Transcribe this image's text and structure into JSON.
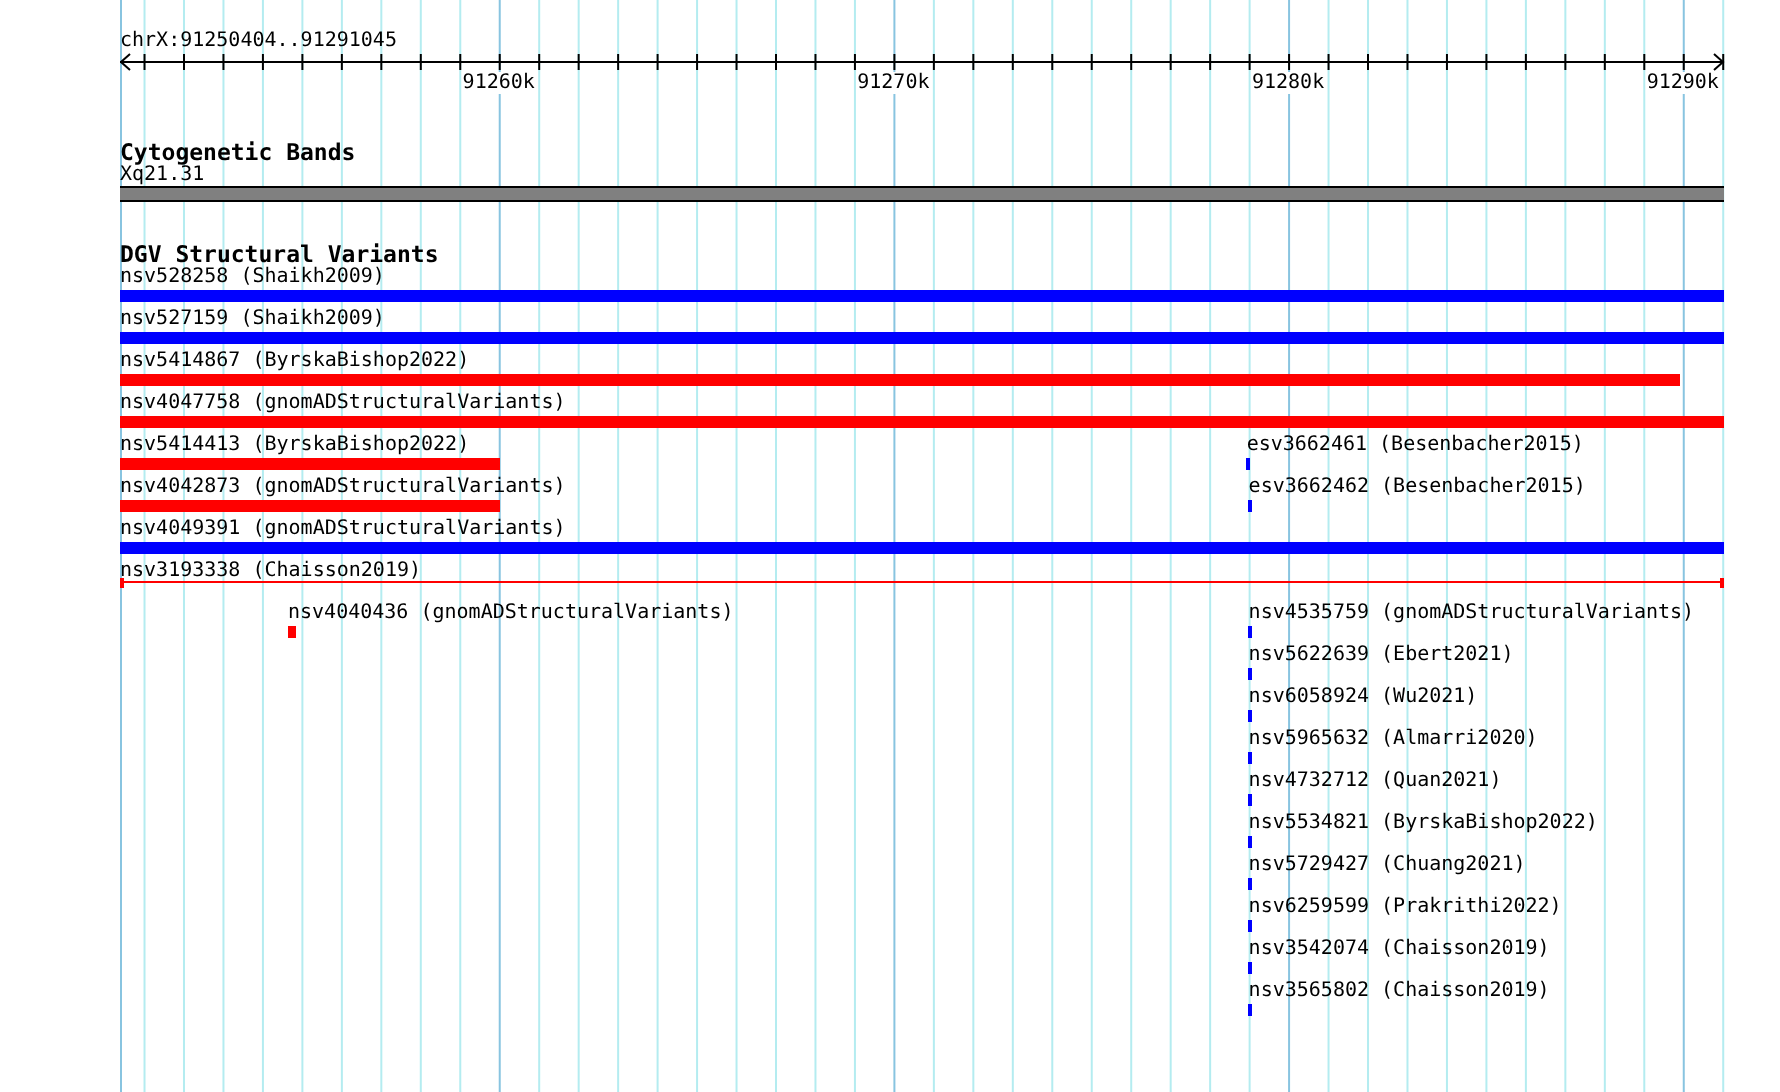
{
  "ruler": {
    "location": "chrX:91250404..91291045",
    "ticks": [
      "91260k",
      "91270k",
      "91280k",
      "91290k"
    ]
  },
  "cytogenetic_track": {
    "title": "Cytogenetic Bands",
    "band": "Xq21.31"
  },
  "dgv_track": {
    "title": "DGV Structural Variants",
    "rows": [
      {
        "features": [
          {
            "label": "nsv528258 (Shaikh2009)",
            "color": "#0000ff",
            "kind": "bar"
          }
        ]
      },
      {
        "features": [
          {
            "label": "nsv527159 (Shaikh2009)",
            "color": "#0000ff",
            "kind": "bar"
          }
        ]
      },
      {
        "features": [
          {
            "label": "nsv5414867 (ByrskaBishop2022)",
            "color": "#ff0000",
            "kind": "bar"
          }
        ]
      },
      {
        "features": [
          {
            "label": "nsv4047758 (gnomADStructuralVariants)",
            "color": "#ff0000",
            "kind": "bar"
          }
        ]
      },
      {
        "features": [
          {
            "label": "nsv5414413 (ByrskaBishop2022)",
            "color": "#ff0000",
            "kind": "bar"
          },
          {
            "label": "esv3662461 (Besenbacher2015)",
            "color": "#0000ff",
            "kind": "bar"
          }
        ]
      },
      {
        "features": [
          {
            "label": "nsv4042873 (gnomADStructuralVariants)",
            "color": "#ff0000",
            "kind": "bar"
          },
          {
            "label": "esv3662462 (Besenbacher2015)",
            "color": "#0000ff",
            "kind": "bar"
          }
        ]
      },
      {
        "features": [
          {
            "label": "nsv4049391 (gnomADStructuralVariants)",
            "color": "#0000ff",
            "kind": "bar"
          }
        ]
      },
      {
        "features": [
          {
            "label": "nsv3193338 (Chaisson2019)",
            "color": "#ff0000",
            "kind": "line"
          }
        ]
      },
      {
        "features": [
          {
            "label": "nsv4040436 (gnomADStructuralVariants)",
            "color": "#ff0000",
            "kind": "bar"
          },
          {
            "label": "nsv4535759 (gnomADStructuralVariants)",
            "color": "#0000ff",
            "kind": "bar"
          }
        ]
      },
      {
        "features": [
          {
            "label": "nsv5622639 (Ebert2021)",
            "color": "#0000ff",
            "kind": "bar"
          }
        ]
      },
      {
        "features": [
          {
            "label": "nsv6058924 (Wu2021)",
            "color": "#0000ff",
            "kind": "bar"
          }
        ]
      },
      {
        "features": [
          {
            "label": "nsv5965632 (Almarri2020)",
            "color": "#0000ff",
            "kind": "bar"
          }
        ]
      },
      {
        "features": [
          {
            "label": "nsv4732712 (Quan2021)",
            "color": "#0000ff",
            "kind": "bar"
          }
        ]
      },
      {
        "features": [
          {
            "label": "nsv5534821 (ByrskaBishop2022)",
            "color": "#0000ff",
            "kind": "bar"
          }
        ]
      },
      {
        "features": [
          {
            "label": "nsv5729427 (Chuang2021)",
            "color": "#0000ff",
            "kind": "bar"
          }
        ]
      },
      {
        "features": [
          {
            "label": "nsv6259599 (Prakrithi2022)",
            "color": "#0000ff",
            "kind": "bar"
          }
        ]
      },
      {
        "features": [
          {
            "label": "nsv3542074 (Chaisson2019)",
            "color": "#0000ff",
            "kind": "bar"
          }
        ]
      },
      {
        "features": [
          {
            "label": "nsv3565802 (Chaisson2019)",
            "color": "#0000ff",
            "kind": "bar"
          }
        ]
      }
    ]
  }
}
